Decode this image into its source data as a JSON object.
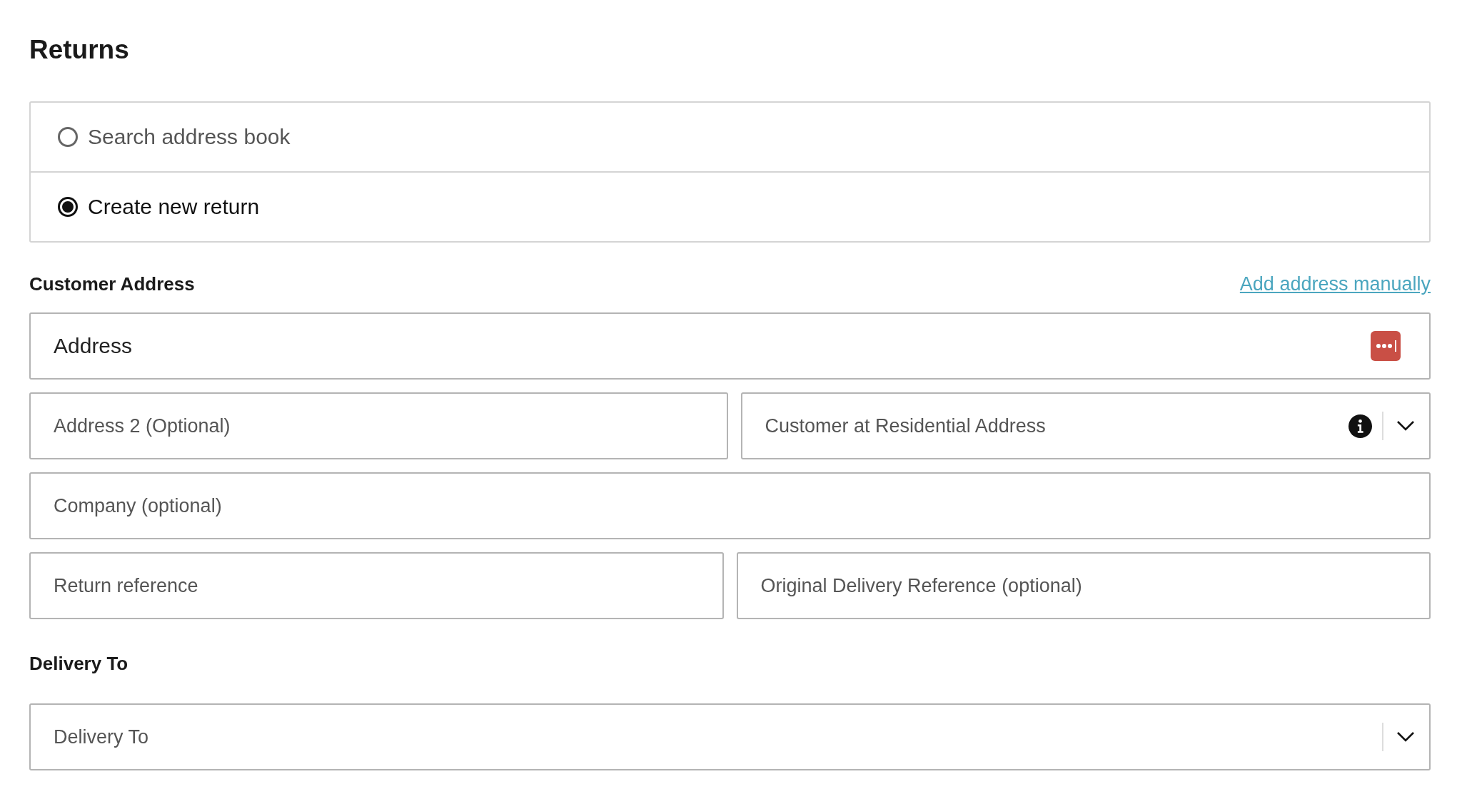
{
  "title": "Returns",
  "options": [
    {
      "label": "Search address book",
      "selected": false
    },
    {
      "label": "Create new return",
      "selected": true
    }
  ],
  "customer_address": {
    "label": "Customer Address",
    "link": "Add address manually",
    "rows": [
      [
        {
          "kind": "text",
          "placeholder": "Address",
          "trailing": {
            "kind": "password_manager"
          }
        }
      ],
      [
        {
          "kind": "text",
          "placeholder": "Address 2 (Optional)"
        },
        {
          "kind": "select",
          "placeholder": "Customer at Residential Address",
          "trailing": {
            "kind": "info"
          }
        }
      ],
      [
        {
          "kind": "text",
          "placeholder": "Company (optional)"
        }
      ],
      [
        {
          "kind": "text",
          "placeholder": "Return reference"
        },
        {
          "kind": "text",
          "placeholder": "Original Delivery Reference (optional)"
        }
      ]
    ]
  },
  "delivery_to": {
    "label": "Delivery To",
    "rows": [
      [
        {
          "kind": "select",
          "placeholder": "Delivery To"
        }
      ]
    ]
  }
}
